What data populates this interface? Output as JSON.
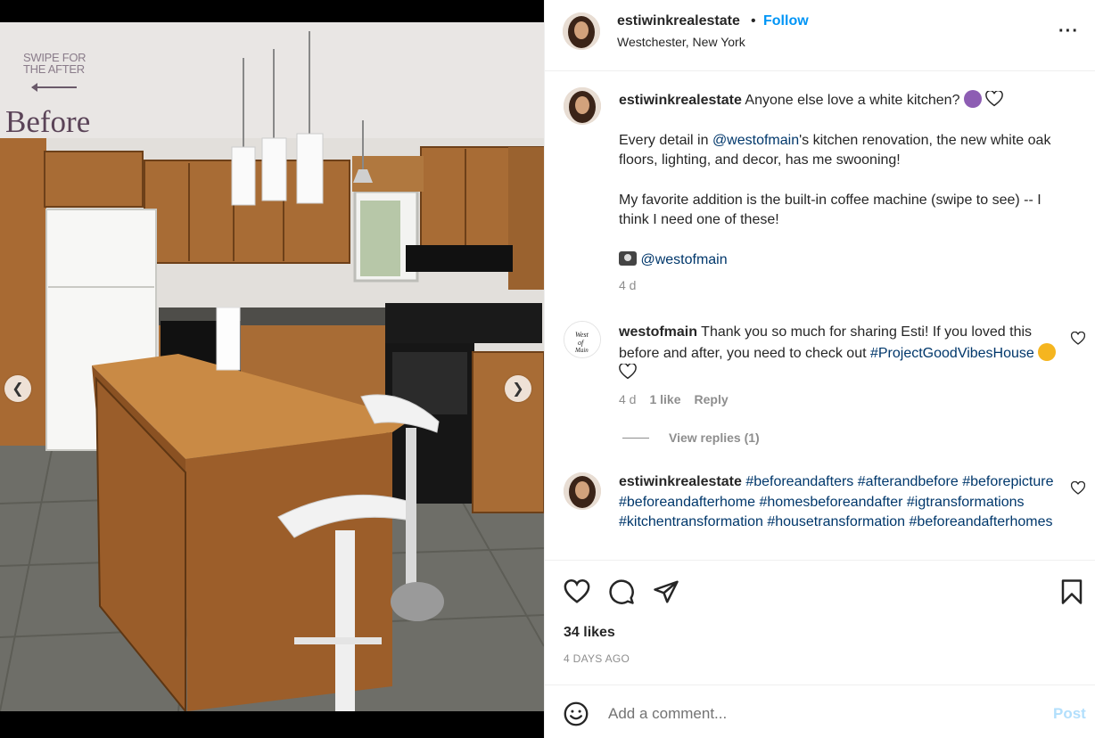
{
  "media": {
    "overlay_swipe": "SWIPE FOR THE AFTER",
    "overlay_before": "Before",
    "prev_icon": "chevron-left-icon",
    "next_icon": "chevron-right-icon",
    "dots_total": 5,
    "active_dot": 2
  },
  "header": {
    "username": "estiwinkrealestate",
    "separator": "•",
    "follow_label": "Follow",
    "location": "Westchester, New York",
    "more_icon": "more-options-icon"
  },
  "caption": {
    "username": "estiwinkrealestate",
    "line1": "Anyone else love a white kitchen?",
    "p2_before": "Every detail in ",
    "p2_mention": "@westofmain",
    "p2_after": "'s kitchen renovation, the new white oak floors, lighting, and decor, has me swooning!",
    "p3": "My favorite addition is the built-in coffee machine (swipe to see) -- I think I need one of these!",
    "camera_mention": "@westofmain",
    "time": "4 d"
  },
  "comment1": {
    "username": "westofmain",
    "text": "Thank you so much for sharing Esti! If you loved this before and after, you need to check out",
    "hashtag": "#ProjectGoodVibesHouse",
    "time": "4 d",
    "likes": "1 like",
    "reply": "Reply",
    "view_replies": "View replies (1)"
  },
  "comment2": {
    "username": "estiwinkrealestate",
    "hashtags": [
      "#beforeandafters",
      "#afterandbefore",
      "#beforepicture",
      "#beforeandafterhome",
      "#homesbeforeandafter",
      "#igtransformations",
      "#kitchentransformation",
      "#housetransformation",
      "#beforeandafterhomes"
    ]
  },
  "actions": {
    "likes": "34 likes",
    "time_ago": "4 DAYS AGO"
  },
  "add_comment": {
    "placeholder": "Add a comment...",
    "post_label": "Post"
  },
  "colors": {
    "accent": "#0095f6",
    "link": "#00376b",
    "muted": "#8e8e8e",
    "post_disabled": "#b2dffc"
  }
}
